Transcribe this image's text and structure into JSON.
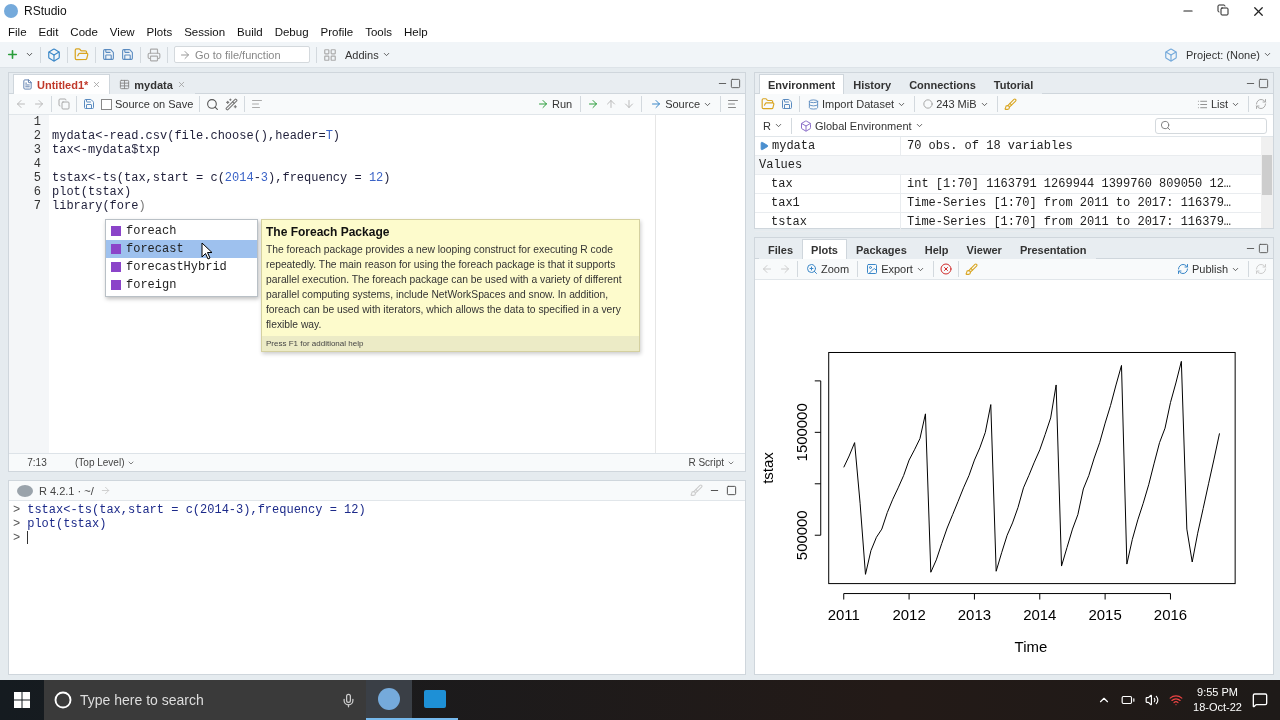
{
  "window": {
    "title": "RStudio"
  },
  "menu": [
    "File",
    "Edit",
    "Code",
    "View",
    "Plots",
    "Session",
    "Build",
    "Debug",
    "Profile",
    "Tools",
    "Help"
  ],
  "toolbar": {
    "goto_placeholder": "Go to file/function",
    "addins": "Addins",
    "project": "Project: (None)"
  },
  "editor": {
    "tabs": [
      {
        "label": "Untitled1*",
        "selected": true,
        "kind": "script",
        "modified": true
      },
      {
        "label": "mydata",
        "selected": false,
        "kind": "table",
        "modified": false
      }
    ],
    "source_on_save": {
      "label": "Source on Save",
      "checked": false
    },
    "run": "Run",
    "source": "Source",
    "lines": [
      {
        "number": "1"
      },
      {
        "number": "2",
        "tokens": [
          {
            "text": "mydata<-read.csv(file.choose(),header=",
            "kind": "plain"
          },
          {
            "text": "T",
            "kind": "constant"
          },
          {
            "text": ")",
            "kind": "plain"
          }
        ]
      },
      {
        "number": "3",
        "tokens": [
          {
            "text": "tax<-mydata$txp",
            "kind": "plain"
          }
        ]
      },
      {
        "number": "4"
      },
      {
        "number": "5",
        "tokens": [
          {
            "text": "tstax<-ts(tax,start = c(",
            "kind": "plain"
          },
          {
            "text": "2014",
            "kind": "number"
          },
          {
            "text": "-",
            "kind": "plain"
          },
          {
            "text": "3",
            "kind": "number"
          },
          {
            "text": "),frequency = ",
            "kind": "plain"
          },
          {
            "text": "12",
            "kind": "number"
          },
          {
            "text": ")",
            "kind": "plain"
          }
        ]
      },
      {
        "number": "6",
        "tokens": [
          {
            "text": "plot(tstax)",
            "kind": "plain"
          }
        ]
      },
      {
        "number": "7",
        "tokens": [
          {
            "text": "library(fore",
            "kind": "plain"
          },
          {
            "text": ")",
            "kind": "paren"
          }
        ]
      }
    ],
    "autocomplete": {
      "items": [
        {
          "label": "foreach",
          "selected": false
        },
        {
          "label": "forecast",
          "selected": true
        },
        {
          "label": "forecastHybrid",
          "selected": false
        },
        {
          "label": "foreign",
          "selected": false
        }
      ],
      "help": {
        "title": "The Foreach Package",
        "body": "The foreach package provides a new looping construct for executing R code repeatedly. The main reason for using the foreach package is that it supports parallel execution. The foreach package can be used with a variety of different parallel computing systems, include NetWorkSpaces and snow. In addition, foreach can be used with iterators, which allows the data to specified in a very flexible way.",
        "footer": "Press F1 for additional help"
      }
    },
    "status": {
      "position": "7:13",
      "scope": "(Top Level)",
      "type": "R Script"
    }
  },
  "console": {
    "title": "R 4.2.1 · ~/",
    "lines": [
      {
        "prompt": ">",
        "text": "tstax<-ts(tax,start = c(2014-3),frequency = 12)"
      },
      {
        "prompt": ">",
        "text": "plot(tstax)"
      },
      {
        "prompt": ">"
      }
    ]
  },
  "environment": {
    "tabs": [
      {
        "label": "Environment",
        "selected": true
      },
      {
        "label": "History",
        "selected": false
      },
      {
        "label": "Connections",
        "selected": false
      },
      {
        "label": "Tutorial",
        "selected": false
      }
    ],
    "import": "Import Dataset",
    "memory": "243 MiB",
    "view": "List",
    "language": "R",
    "scope": "Global Environment",
    "data": [
      {
        "name": "mydata",
        "value": "70 obs. of 18 variables"
      }
    ],
    "section": "Values",
    "values": [
      {
        "name": "tax",
        "value": "int [1:70] 1163791 1269944 1399760 809050 12…"
      },
      {
        "name": "tax1",
        "value": "Time-Series [1:70] from 2011 to 2017: 116379…"
      },
      {
        "name": "tstax",
        "value": "Time-Series [1:70] from 2011 to 2017: 116379…"
      }
    ]
  },
  "plots": {
    "tabs": [
      {
        "label": "Files",
        "selected": false
      },
      {
        "label": "Plots",
        "selected": true
      },
      {
        "label": "Packages",
        "selected": false
      },
      {
        "label": "Help",
        "selected": false
      },
      {
        "label": "Viewer",
        "selected": false
      },
      {
        "label": "Presentation",
        "selected": false
      }
    ],
    "zoom": "Zoom",
    "export": "Export",
    "publish": "Publish",
    "chart_data": {
      "type": "line",
      "xlabel": "Time",
      "ylabel": "tstax",
      "xlim": [
        2010.77,
        2016.99
      ],
      "ylim": [
        30000,
        2276000
      ],
      "xticks": [
        2011,
        2012,
        2013,
        2014,
        2015,
        2016
      ],
      "yticks": [
        500000,
        1500000
      ],
      "x": [
        2011,
        2011.083,
        2011.167,
        2011.25,
        2011.333,
        2011.417,
        2011.5,
        2011.583,
        2011.667,
        2011.75,
        2011.833,
        2011.917,
        2012,
        2012.083,
        2012.167,
        2012.25,
        2012.333,
        2012.417,
        2012.5,
        2012.583,
        2012.667,
        2012.75,
        2012.833,
        2012.917,
        2013,
        2013.083,
        2013.167,
        2013.25,
        2013.333,
        2013.417,
        2013.5,
        2013.583,
        2013.667,
        2013.75,
        2013.833,
        2013.917,
        2014,
        2014.083,
        2014.167,
        2014.25,
        2014.333,
        2014.417,
        2014.5,
        2014.583,
        2014.667,
        2014.75,
        2014.833,
        2014.917,
        2015,
        2015.083,
        2015.167,
        2015.25,
        2015.333,
        2015.417,
        2015.5,
        2015.583,
        2015.667,
        2015.75,
        2015.833,
        2015.917,
        2016,
        2016.083,
        2016.167,
        2016.25,
        2016.333,
        2016.417,
        2016.5,
        2016.583,
        2016.667,
        2016.75
      ],
      "series": [
        {
          "color": "#000000",
          "values": [
            1160000,
            1270000,
            1400000,
            810000,
            120000,
            350000,
            480000,
            560000,
            720000,
            850000,
            960000,
            1080000,
            1230000,
            1330000,
            1440000,
            1680000,
            140000,
            260000,
            420000,
            570000,
            700000,
            830000,
            960000,
            1080000,
            1230000,
            1350000,
            1500000,
            1770000,
            150000,
            330000,
            500000,
            620000,
            770000,
            960000,
            1080000,
            1210000,
            1330000,
            1480000,
            1640000,
            1960000,
            200000,
            380000,
            560000,
            700000,
            950000,
            1080000,
            1250000,
            1400000,
            1590000,
            1760000,
            1960000,
            2150000,
            220000,
            460000,
            650000,
            810000,
            990000,
            1200000,
            1400000,
            1540000,
            1790000,
            1980000,
            2190000,
            560000,
            240000,
            520000,
            760000,
            1000000,
            1240000,
            1490000
          ]
        }
      ]
    }
  },
  "taskbar": {
    "search_placeholder": "Type here to search",
    "time": "9:55 PM",
    "date": "18-Oct-22"
  }
}
